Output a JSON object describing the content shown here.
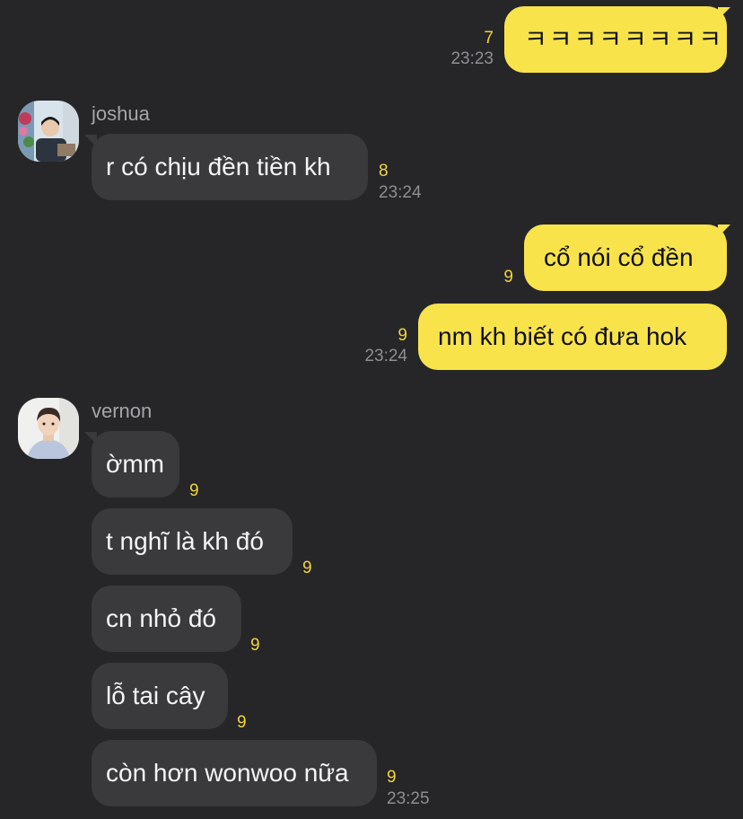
{
  "messages": {
    "m1": {
      "text": "ㅋㅋㅋㅋㅋㅋㅋㅋ",
      "unread": "7",
      "time": "23:23"
    },
    "joshua": {
      "sender": "joshua",
      "m2": {
        "text": "r có chịu đền tiền kh",
        "unread": "8",
        "time": "23:24"
      }
    },
    "m3": {
      "text": "cổ nói cổ đền",
      "unread": "9"
    },
    "m4": {
      "text": "nm kh biết có đưa hok",
      "unread": "9",
      "time": "23:24"
    },
    "vernon": {
      "sender": "vernon",
      "m5": {
        "text": "ờmm",
        "unread": "9"
      },
      "m6": {
        "text": "t nghĩ là kh đó",
        "unread": "9"
      },
      "m7": {
        "text": "cn nhỏ đó",
        "unread": "9"
      },
      "m8": {
        "text": "lỗ tai cây",
        "unread": "9"
      },
      "m9": {
        "text": "còn hơn wonwoo nữa",
        "unread": "9",
        "time": "23:25"
      }
    }
  },
  "colors": {
    "background": "#262628",
    "outgoing_bubble": "#f8e34b",
    "incoming_bubble": "#3a3a3c",
    "unread_count": "#f2d53b",
    "timestamp": "#8e8e93"
  },
  "icons": {
    "joshua_avatar": "profile-photo",
    "vernon_avatar": "profile-photo"
  }
}
